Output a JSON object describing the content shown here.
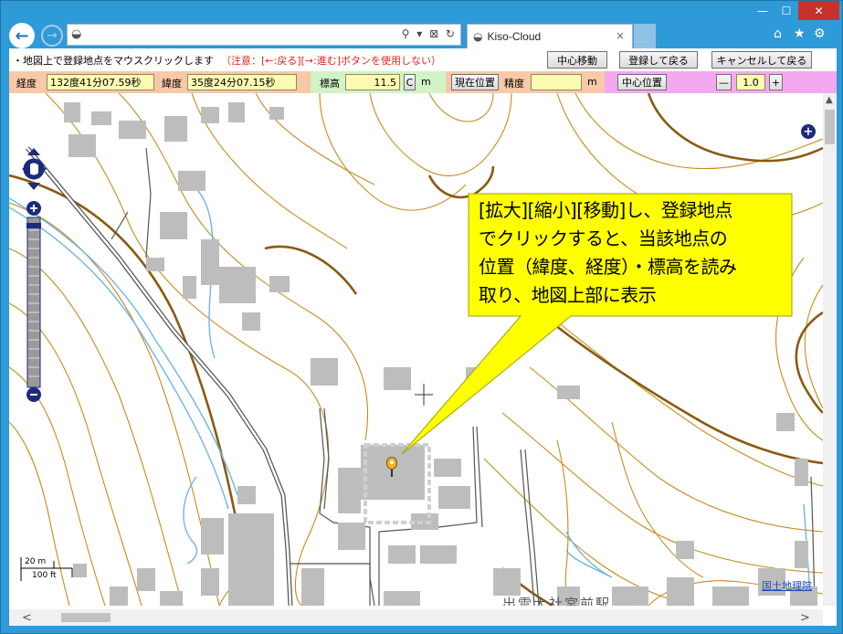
{
  "window": {
    "minimize_glyph": "—",
    "maximize_glyph": "☐",
    "close_glyph": "✕"
  },
  "browser": {
    "back_icon": "arrow-left-icon",
    "forward_icon": "arrow-right-icon",
    "address_icons": "⚲ ▾ ⊠ ↻",
    "tab_title": "Kiso-Cloud",
    "tab_close": "×",
    "icons": {
      "home": "⌂",
      "favorites": "★",
      "settings": "⚙"
    }
  },
  "toolbar1": {
    "instruction": "・地図上で登録地点をマウスクリックします",
    "note": "（注意：[←:戻る][→:進む]ボタンを使用しない）",
    "center_move_label": "中心移動",
    "register_return_label": "登録して戻る",
    "cancel_return_label": "キャンセルして戻る"
  },
  "toolbar2": {
    "longitude_label": "経度",
    "longitude_value": "132度41分07.59秒",
    "latitude_label": "緯度",
    "latitude_value": "35度24分07.15秒",
    "elevation_label": "標高",
    "elevation_value": "11.5",
    "elevation_clear_label": "C",
    "elevation_unit": "m",
    "current_position_label": "現在位置",
    "accuracy_label": "精度",
    "accuracy_value": "",
    "accuracy_unit": "m",
    "center_position_label": "中心位置",
    "zoom_minus_label": "—",
    "zoom_value": "1.0",
    "zoom_plus_label": "+"
  },
  "map": {
    "callout_lines": [
      "[拡大][縮小][移動]し、登録地点",
      "でクリックすると、当該地点の",
      "位置（緯度、経度）・標高を読み",
      "取り、地図上部に表示"
    ],
    "scale_top": "20 m",
    "scale_bottom": "100 ft",
    "attribution": "国土地理院",
    "bottom_map_text": "出雲大社宮前駅",
    "colors": {
      "contour": "#c98a1a",
      "contour_index": "#8a5a10",
      "building": "#bdbdbd",
      "road": "#555555",
      "water": "#6fb4e8",
      "callout": "#ffff00"
    }
  },
  "scrollbars": {
    "left_arrow": "<",
    "right_arrow": ">",
    "up_arrow": "▲"
  }
}
